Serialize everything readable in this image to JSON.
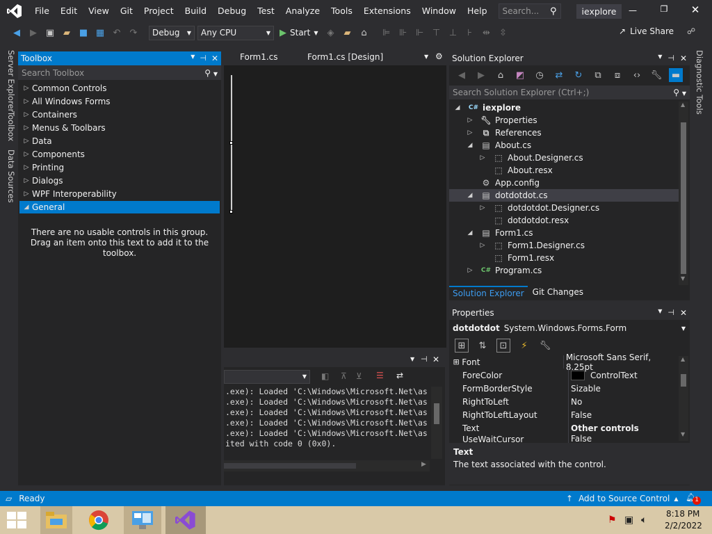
{
  "menu": {
    "items": [
      "File",
      "Edit",
      "View",
      "Git",
      "Project",
      "Build",
      "Debug",
      "Test",
      "Analyze",
      "Tools",
      "Extensions",
      "Window",
      "Help"
    ],
    "search_placeholder": "Search...",
    "project_name": "iexplore"
  },
  "toolbar": {
    "configuration": "Debug",
    "platform": "Any CPU",
    "start_label": "Start",
    "live_share_label": "Live Share"
  },
  "side_tabs": {
    "left": [
      "Server Explorer",
      "Toolbox",
      "Data Sources"
    ],
    "right": [
      "Diagnostic Tools"
    ]
  },
  "toolbox": {
    "title": "Toolbox",
    "search_placeholder": "Search Toolbox",
    "groups": [
      "Common Controls",
      "All Windows Forms",
      "Containers",
      "Menus & Toolbars",
      "Data",
      "Components",
      "Printing",
      "Dialogs",
      "WPF Interoperability",
      "General"
    ],
    "empty_message": "There are no usable controls in this group. Drag an item onto this text to add it to the toolbox."
  },
  "editor": {
    "tabs": [
      "Form1.cs",
      "Form1.cs [Design]"
    ]
  },
  "output": {
    "lines": [
      ".exe): Loaded 'C:\\Windows\\Microsoft.Net\\as",
      ".exe): Loaded 'C:\\Windows\\Microsoft.Net\\as",
      ".exe): Loaded 'C:\\Windows\\Microsoft.Net\\as",
      ".exe): Loaded 'C:\\Windows\\Microsoft.Net\\as",
      ".exe): Loaded 'C:\\Windows\\Microsoft.Net\\as",
      "ited with code 0 (0x0)."
    ]
  },
  "solution_explorer": {
    "title": "Solution Explorer",
    "search_placeholder": "Search Solution Explorer (Ctrl+;)",
    "tree": [
      {
        "label": "iexplore",
        "depth": 0,
        "expand": "open",
        "icon": "csharp-project-icon"
      },
      {
        "label": "Properties",
        "depth": 1,
        "expand": "closed",
        "icon": "wrench-icon"
      },
      {
        "label": "References",
        "depth": 1,
        "expand": "closed",
        "icon": "references-icon"
      },
      {
        "label": "About.cs",
        "depth": 1,
        "expand": "open",
        "icon": "form-icon"
      },
      {
        "label": "About.Designer.cs",
        "depth": 2,
        "expand": "closed",
        "icon": "designer-file-icon"
      },
      {
        "label": "About.resx",
        "depth": 2,
        "expand": "none",
        "icon": "resx-icon"
      },
      {
        "label": "App.config",
        "depth": 1,
        "expand": "none",
        "icon": "config-icon"
      },
      {
        "label": "dotdotdot.cs",
        "depth": 1,
        "expand": "open",
        "icon": "form-icon"
      },
      {
        "label": "dotdotdot.Designer.cs",
        "depth": 2,
        "expand": "closed",
        "icon": "designer-file-icon"
      },
      {
        "label": "dotdotdot.resx",
        "depth": 2,
        "expand": "none",
        "icon": "resx-icon"
      },
      {
        "label": "Form1.cs",
        "depth": 1,
        "expand": "open",
        "icon": "form-icon"
      },
      {
        "label": "Form1.Designer.cs",
        "depth": 2,
        "expand": "closed",
        "icon": "designer-file-icon"
      },
      {
        "label": "Form1.resx",
        "depth": 2,
        "expand": "none",
        "icon": "resx-icon"
      },
      {
        "label": "Program.cs",
        "depth": 1,
        "expand": "closed",
        "icon": "csharp-file-icon"
      }
    ],
    "tabs": [
      "Solution Explorer",
      "Git Changes"
    ]
  },
  "properties": {
    "title": "Properties",
    "object_name": "dotdotdot",
    "object_type": "System.Windows.Forms.Form",
    "rows": [
      {
        "name": "Font",
        "value": "Microsoft Sans Serif, 8.25pt",
        "expandable": true
      },
      {
        "name": "ForeColor",
        "value": "ControlText",
        "swatch": "#000000"
      },
      {
        "name": "FormBorderStyle",
        "value": "Sizable"
      },
      {
        "name": "RightToLeft",
        "value": "No"
      },
      {
        "name": "RightToLeftLayout",
        "value": "False"
      },
      {
        "name": "Text",
        "value": "Other controls",
        "bold": true
      },
      {
        "name": "UseWaitCursor",
        "value": "False"
      }
    ],
    "desc_title": "Text",
    "desc_text": "The text associated with the control."
  },
  "status": {
    "ready": "Ready",
    "source_control": "Add to Source Control",
    "notification_count": "1"
  },
  "taskbar": {
    "time": "8:18 PM",
    "date": "2/2/2022"
  },
  "colors": {
    "accent": "#007acc",
    "status_bar": "#007acc",
    "selection": "#3f3f46",
    "bg": "#2d2d30",
    "panel": "#252526",
    "editor": "#1e1e1e"
  }
}
